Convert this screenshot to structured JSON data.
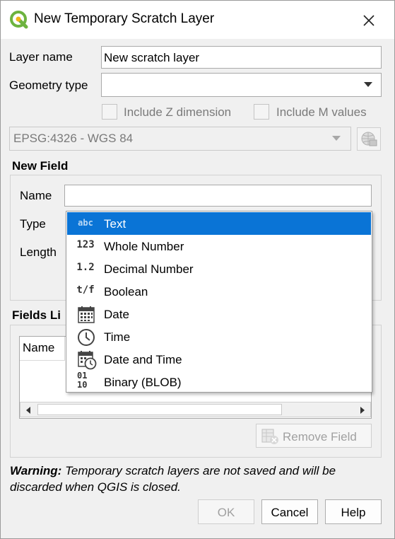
{
  "window": {
    "title": "New Temporary Scratch Layer"
  },
  "form": {
    "layer_name_label": "Layer name",
    "layer_name_value": "New scratch layer",
    "geometry_type_label": "Geometry type",
    "geometry_type_value": "",
    "include_z_label": "Include Z dimension",
    "include_m_label": "Include M values",
    "crs_value": "EPSG:4326 - WGS 84"
  },
  "new_field": {
    "section_title": "New Field",
    "name_label": "Name",
    "name_value": "",
    "type_label": "Type",
    "length_label": "Length"
  },
  "type_dropdown": {
    "options": [
      {
        "icon": "abc",
        "label": "Text",
        "selected": true
      },
      {
        "icon": "123",
        "label": "Whole Number"
      },
      {
        "icon": "1.2",
        "label": "Decimal Number"
      },
      {
        "icon": "t/f",
        "label": "Boolean"
      },
      {
        "icon": "calendar-icon",
        "label": "Date"
      },
      {
        "icon": "clock-icon",
        "label": "Time"
      },
      {
        "icon": "calendar-clock-icon",
        "label": "Date and Time"
      },
      {
        "icon": "binary-icon",
        "label": "Binary (BLOB)",
        "icon_text": "01 10"
      }
    ]
  },
  "fields_list": {
    "section_title": "Fields Li",
    "column_header": "Name",
    "remove_button": "Remove Field"
  },
  "warning": {
    "bold": "Warning:",
    "text": "Temporary scratch layers are not saved and will be discarded when QGIS is closed."
  },
  "buttons": {
    "ok": "OK",
    "cancel": "Cancel",
    "help": "Help"
  },
  "colors": {
    "accent": "#0a74d6",
    "qgis_green": "#6db33f"
  }
}
